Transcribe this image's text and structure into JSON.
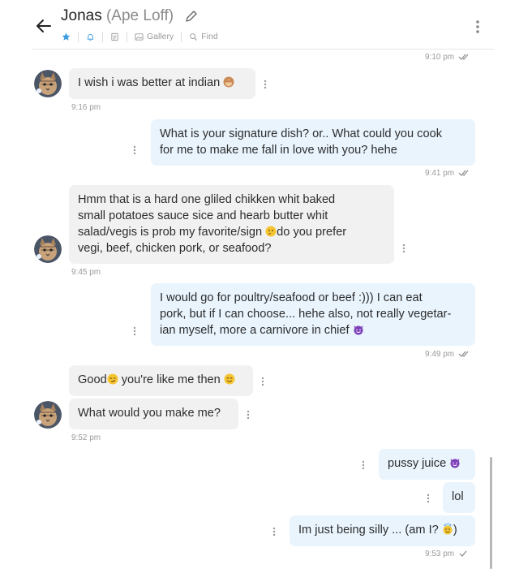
{
  "header": {
    "name": "Jonas",
    "subtitle": "(Ape Loff)",
    "tabs": {
      "gallery": "Gallery",
      "find": "Find"
    }
  },
  "messages": {
    "t0": "9:10 pm",
    "m1": "I wish i was better at indian",
    "t1": "9:16 pm",
    "m2a": "What is your signature dish? or.. What could you cook",
    "m2b": "for me to make me fall in love with you? hehe",
    "t2": "9:41 pm",
    "m3a": "Hmm that is a hard one gliled chikken whit baked",
    "m3b": "small potatoes sauce sice and hearb butter whit",
    "m3c1": "salad/vegis is prob my favorite/sign ",
    "m3c2": "do you prefer",
    "m3d": "vegi, beef, chicken pork, or seafood?",
    "t3": "9:45 pm",
    "m4a": "I would go for poultry/seafood or beef :))) I can eat",
    "m4b": "pork, but if I can choose... hehe also, not really vegetar-",
    "m4c": "ian myself, more a carnivore in chief",
    "t4": "9:49 pm",
    "m5a": "Good",
    "m5b": " you're like me then",
    "m6": "What would you make me?",
    "t5": "9:52 pm",
    "m7": "pussy juice",
    "m8": "lol",
    "m9a": "Im just being silly ... (am I?",
    "m9b": ")",
    "t6": "9:53 pm"
  },
  "colors": {
    "incoming_bubble": "#f1f1f1",
    "outgoing_bubble": "#e9f4fd",
    "accent": "#3d9be0"
  }
}
